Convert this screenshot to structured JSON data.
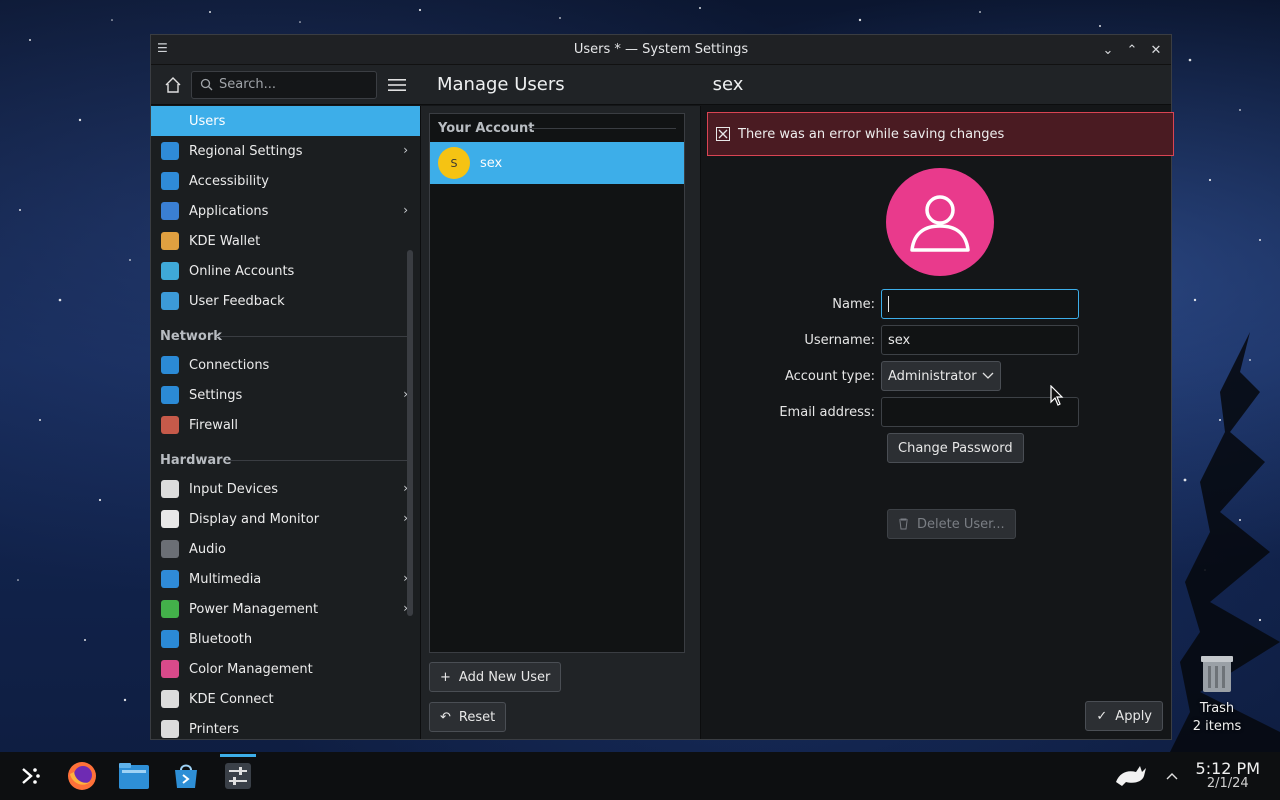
{
  "window": {
    "title": "Users * — System Settings"
  },
  "header": {
    "search_placeholder": "Search...",
    "page_title": "Manage Users",
    "user_title": "sex"
  },
  "sidebar": {
    "items_top": [
      {
        "label": "Users",
        "icon": "users-icon",
        "color": "#3daee9",
        "chevron": false,
        "active": true
      },
      {
        "label": "Regional Settings",
        "icon": "regional-settings-icon",
        "color": "#2f8bd8",
        "chevron": true
      },
      {
        "label": "Accessibility",
        "icon": "accessibility-icon",
        "color": "#2f8bd8",
        "chevron": false
      },
      {
        "label": "Applications",
        "icon": "applications-icon",
        "color": "#3a7fd3",
        "chevron": true
      },
      {
        "label": "KDE Wallet",
        "icon": "wallet-icon",
        "color": "#e0a040",
        "chevron": false
      },
      {
        "label": "Online Accounts",
        "icon": "online-accounts-icon",
        "color": "#3fa9d8",
        "chevron": false
      },
      {
        "label": "User Feedback",
        "icon": "feedback-icon",
        "color": "#3c9ad8",
        "chevron": false
      }
    ],
    "network_header": "Network",
    "items_network": [
      {
        "label": "Connections",
        "icon": "globe-icon",
        "color": "#2b8ad6",
        "chevron": false
      },
      {
        "label": "Settings",
        "icon": "globe-settings-icon",
        "color": "#2b8ad6",
        "chevron": true
      },
      {
        "label": "Firewall",
        "icon": "firewall-icon",
        "color": "#c65a4a",
        "chevron": false
      }
    ],
    "hardware_header": "Hardware",
    "items_hardware": [
      {
        "label": "Input Devices",
        "icon": "mouse-icon",
        "color": "#dcdcdc",
        "chevron": true
      },
      {
        "label": "Display and Monitor",
        "icon": "monitor-icon",
        "color": "#e8e8e8",
        "chevron": true
      },
      {
        "label": "Audio",
        "icon": "speaker-icon",
        "color": "#6b6f75",
        "chevron": false
      },
      {
        "label": "Multimedia",
        "icon": "multimedia-icon",
        "color": "#2f8bd8",
        "chevron": true
      },
      {
        "label": "Power Management",
        "icon": "power-icon",
        "color": "#43b04a",
        "chevron": true
      },
      {
        "label": "Bluetooth",
        "icon": "bluetooth-icon",
        "color": "#2b8ad6",
        "chevron": false
      },
      {
        "label": "Color Management",
        "icon": "color-wheel-icon",
        "color": "#d84a8a",
        "chevron": false
      },
      {
        "label": "KDE Connect",
        "icon": "phone-icon",
        "color": "#dcdcdc",
        "chevron": false
      },
      {
        "label": "Printers",
        "icon": "printer-icon",
        "color": "#dcdcdc",
        "chevron": false
      }
    ]
  },
  "userlist": {
    "heading": "Your Account",
    "user": {
      "initial": "S",
      "name": "sex"
    },
    "add_label": "Add New User",
    "reset_label": "Reset"
  },
  "details": {
    "error_text": "There was an error while saving changes",
    "name_label": "Name:",
    "name_value": "",
    "username_label": "Username:",
    "username_value": "sex",
    "account_type_label": "Account type:",
    "account_type_value": "Administrator",
    "email_label": "Email address:",
    "email_value": "",
    "change_password_label": "Change Password",
    "delete_user_label": "Delete User...",
    "apply_label": "Apply"
  },
  "desktop": {
    "trash_label": "Trash",
    "trash_count": "2 items"
  },
  "taskbar": {
    "time": "5:12 PM",
    "date": "2/1/24"
  },
  "colors": {
    "accent": "#3daee9",
    "error_border": "#da4453",
    "avatar_big": "#e93a8c",
    "avatar_small": "#f5c313"
  }
}
